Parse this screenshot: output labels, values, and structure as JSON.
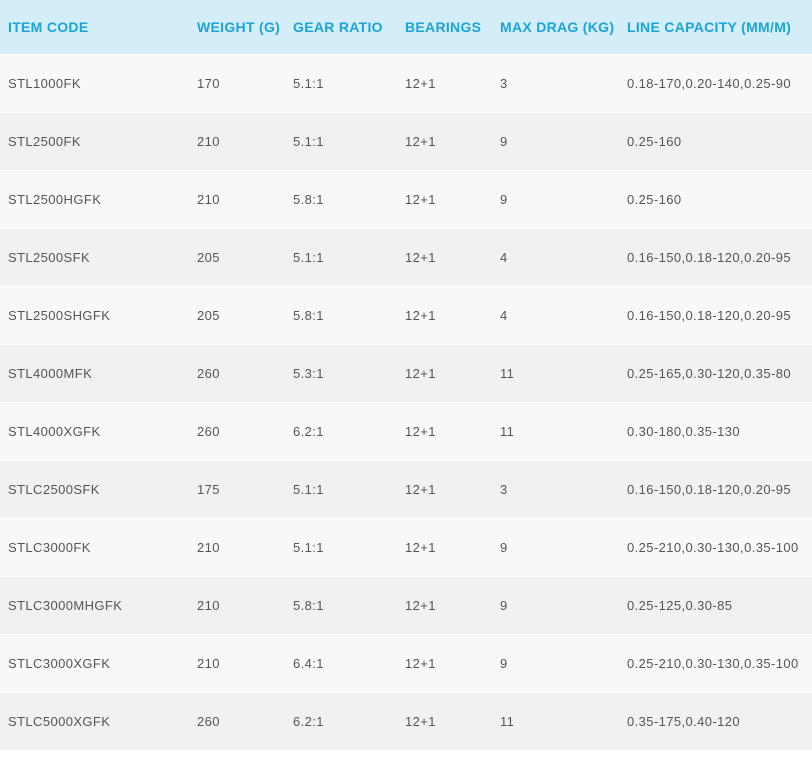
{
  "table": {
    "headers": {
      "item_code": "ITEM CODE",
      "weight": "WEIGHT (G)",
      "gear_ratio": "GEAR RATIO",
      "bearings": "BEARINGS",
      "max_drag": "MAX DRAG (KG)",
      "line_capacity": "LINE CAPACITY (MM/M)"
    },
    "rows": [
      {
        "item_code": "STL1000FK",
        "weight": "170",
        "gear_ratio": "5.1:1",
        "bearings": "12+1",
        "max_drag": "3",
        "line_capacity": "0.18-170,0.20-140,0.25-90"
      },
      {
        "item_code": "STL2500FK",
        "weight": "210",
        "gear_ratio": "5.1:1",
        "bearings": "12+1",
        "max_drag": "9",
        "line_capacity": "0.25-160"
      },
      {
        "item_code": "STL2500HGFK",
        "weight": "210",
        "gear_ratio": "5.8:1",
        "bearings": "12+1",
        "max_drag": "9",
        "line_capacity": "0.25-160"
      },
      {
        "item_code": "STL2500SFK",
        "weight": "205",
        "gear_ratio": "5.1:1",
        "bearings": "12+1",
        "max_drag": "4",
        "line_capacity": "0.16-150,0.18-120,0.20-95"
      },
      {
        "item_code": "STL2500SHGFK",
        "weight": "205",
        "gear_ratio": "5.8:1",
        "bearings": "12+1",
        "max_drag": "4",
        "line_capacity": "0.16-150,0.18-120,0.20-95"
      },
      {
        "item_code": "STL4000MFK",
        "weight": "260",
        "gear_ratio": "5.3:1",
        "bearings": "12+1",
        "max_drag": "11",
        "line_capacity": "0.25-165,0.30-120,0.35-80"
      },
      {
        "item_code": "STL4000XGFK",
        "weight": "260",
        "gear_ratio": "6.2:1",
        "bearings": "12+1",
        "max_drag": "11",
        "line_capacity": "0.30-180,0.35-130"
      },
      {
        "item_code": "STLC2500SFK",
        "weight": "175",
        "gear_ratio": "5.1:1",
        "bearings": "12+1",
        "max_drag": "3",
        "line_capacity": "0.16-150,0.18-120,0.20-95"
      },
      {
        "item_code": "STLC3000FK",
        "weight": "210",
        "gear_ratio": "5.1:1",
        "bearings": "12+1",
        "max_drag": "9",
        "line_capacity": "0.25-210,0.30-130,0.35-100"
      },
      {
        "item_code": "STLC3000MHGFK",
        "weight": "210",
        "gear_ratio": "5.8:1",
        "bearings": "12+1",
        "max_drag": "9",
        "line_capacity": "0.25-125,0.30-85"
      },
      {
        "item_code": "STLC3000XGFK",
        "weight": "210",
        "gear_ratio": "6.4:1",
        "bearings": "12+1",
        "max_drag": "9",
        "line_capacity": "0.25-210,0.30-130,0.35-100"
      },
      {
        "item_code": "STLC5000XGFK",
        "weight": "260",
        "gear_ratio": "6.2:1",
        "bearings": "12+1",
        "max_drag": "11",
        "line_capacity": "0.35-175,0.40-120"
      }
    ]
  },
  "colors": {
    "header_background": "#d3edf9",
    "header_text": "#1ba4d9",
    "row_odd": "#f8f8f8",
    "row_even": "#f1f1f1",
    "cell_text": "#555555"
  }
}
